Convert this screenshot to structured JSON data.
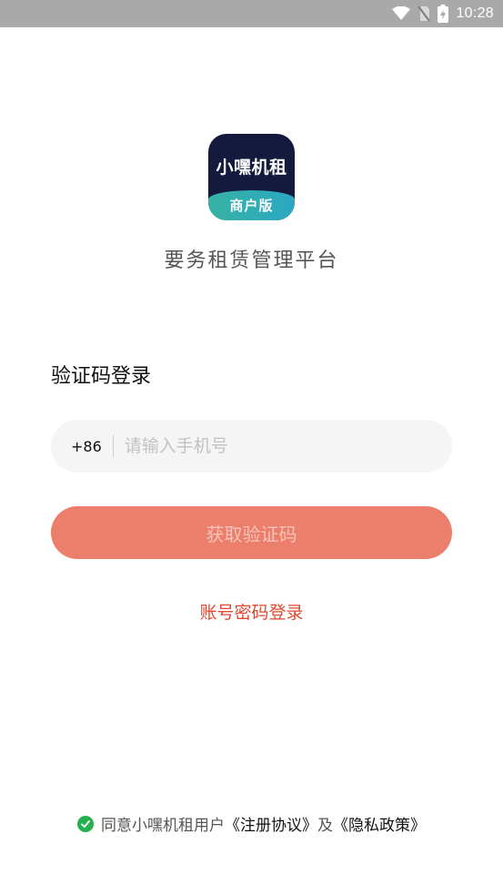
{
  "status_bar": {
    "time": "10:28",
    "icons": [
      "wifi-icon",
      "no-sim-icon",
      "battery-charging-icon"
    ]
  },
  "logo": {
    "main_text": "小嘿机租",
    "sub_text": "商户版",
    "colors": {
      "background": "#131a3d",
      "band": "#37b2a3"
    }
  },
  "subtitle": "要务租赁管理平台",
  "login": {
    "title": "验证码登录",
    "phone_prefix": "+86",
    "phone_value": "",
    "phone_placeholder": "请输入手机号",
    "get_code_label": "获取验证码",
    "account_login_label": "账号密码登录"
  },
  "agreement": {
    "checked": true,
    "prefix_text": "同意小嘿机租用户",
    "register_link": "《注册协议》",
    "middle_text": "及",
    "privacy_link": "《隐私政策》"
  },
  "colors": {
    "accent": "#ec7f6b",
    "link_red": "#e0492f",
    "check_green": "#22b14c"
  }
}
